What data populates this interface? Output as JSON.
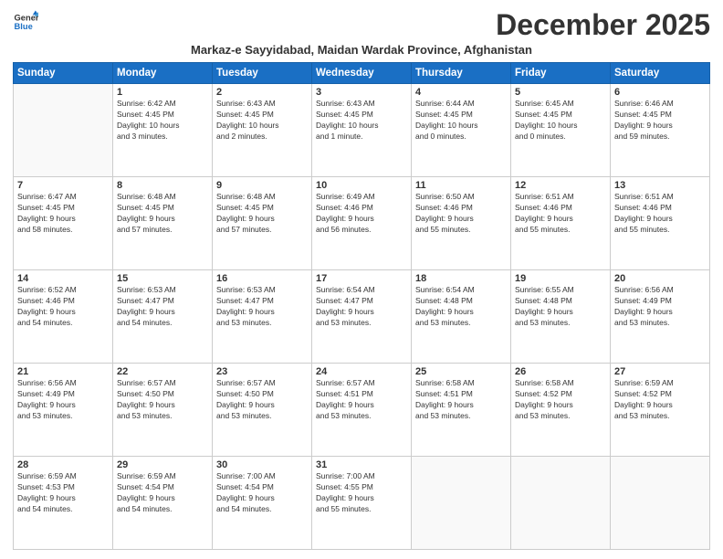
{
  "logo": {
    "line1": "General",
    "line2": "Blue"
  },
  "title": "December 2025",
  "subtitle": "Markaz-e Sayyidabad, Maidan Wardak Province, Afghanistan",
  "weekdays": [
    "Sunday",
    "Monday",
    "Tuesday",
    "Wednesday",
    "Thursday",
    "Friday",
    "Saturday"
  ],
  "weeks": [
    [
      {
        "day": "",
        "info": ""
      },
      {
        "day": "1",
        "info": "Sunrise: 6:42 AM\nSunset: 4:45 PM\nDaylight: 10 hours\nand 3 minutes."
      },
      {
        "day": "2",
        "info": "Sunrise: 6:43 AM\nSunset: 4:45 PM\nDaylight: 10 hours\nand 2 minutes."
      },
      {
        "day": "3",
        "info": "Sunrise: 6:43 AM\nSunset: 4:45 PM\nDaylight: 10 hours\nand 1 minute."
      },
      {
        "day": "4",
        "info": "Sunrise: 6:44 AM\nSunset: 4:45 PM\nDaylight: 10 hours\nand 0 minutes."
      },
      {
        "day": "5",
        "info": "Sunrise: 6:45 AM\nSunset: 4:45 PM\nDaylight: 10 hours\nand 0 minutes."
      },
      {
        "day": "6",
        "info": "Sunrise: 6:46 AM\nSunset: 4:45 PM\nDaylight: 9 hours\nand 59 minutes."
      }
    ],
    [
      {
        "day": "7",
        "info": "Sunrise: 6:47 AM\nSunset: 4:45 PM\nDaylight: 9 hours\nand 58 minutes."
      },
      {
        "day": "8",
        "info": "Sunrise: 6:48 AM\nSunset: 4:45 PM\nDaylight: 9 hours\nand 57 minutes."
      },
      {
        "day": "9",
        "info": "Sunrise: 6:48 AM\nSunset: 4:45 PM\nDaylight: 9 hours\nand 57 minutes."
      },
      {
        "day": "10",
        "info": "Sunrise: 6:49 AM\nSunset: 4:46 PM\nDaylight: 9 hours\nand 56 minutes."
      },
      {
        "day": "11",
        "info": "Sunrise: 6:50 AM\nSunset: 4:46 PM\nDaylight: 9 hours\nand 55 minutes."
      },
      {
        "day": "12",
        "info": "Sunrise: 6:51 AM\nSunset: 4:46 PM\nDaylight: 9 hours\nand 55 minutes."
      },
      {
        "day": "13",
        "info": "Sunrise: 6:51 AM\nSunset: 4:46 PM\nDaylight: 9 hours\nand 55 minutes."
      }
    ],
    [
      {
        "day": "14",
        "info": "Sunrise: 6:52 AM\nSunset: 4:46 PM\nDaylight: 9 hours\nand 54 minutes."
      },
      {
        "day": "15",
        "info": "Sunrise: 6:53 AM\nSunset: 4:47 PM\nDaylight: 9 hours\nand 54 minutes."
      },
      {
        "day": "16",
        "info": "Sunrise: 6:53 AM\nSunset: 4:47 PM\nDaylight: 9 hours\nand 53 minutes."
      },
      {
        "day": "17",
        "info": "Sunrise: 6:54 AM\nSunset: 4:47 PM\nDaylight: 9 hours\nand 53 minutes."
      },
      {
        "day": "18",
        "info": "Sunrise: 6:54 AM\nSunset: 4:48 PM\nDaylight: 9 hours\nand 53 minutes."
      },
      {
        "day": "19",
        "info": "Sunrise: 6:55 AM\nSunset: 4:48 PM\nDaylight: 9 hours\nand 53 minutes."
      },
      {
        "day": "20",
        "info": "Sunrise: 6:56 AM\nSunset: 4:49 PM\nDaylight: 9 hours\nand 53 minutes."
      }
    ],
    [
      {
        "day": "21",
        "info": "Sunrise: 6:56 AM\nSunset: 4:49 PM\nDaylight: 9 hours\nand 53 minutes."
      },
      {
        "day": "22",
        "info": "Sunrise: 6:57 AM\nSunset: 4:50 PM\nDaylight: 9 hours\nand 53 minutes."
      },
      {
        "day": "23",
        "info": "Sunrise: 6:57 AM\nSunset: 4:50 PM\nDaylight: 9 hours\nand 53 minutes."
      },
      {
        "day": "24",
        "info": "Sunrise: 6:57 AM\nSunset: 4:51 PM\nDaylight: 9 hours\nand 53 minutes."
      },
      {
        "day": "25",
        "info": "Sunrise: 6:58 AM\nSunset: 4:51 PM\nDaylight: 9 hours\nand 53 minutes."
      },
      {
        "day": "26",
        "info": "Sunrise: 6:58 AM\nSunset: 4:52 PM\nDaylight: 9 hours\nand 53 minutes."
      },
      {
        "day": "27",
        "info": "Sunrise: 6:59 AM\nSunset: 4:52 PM\nDaylight: 9 hours\nand 53 minutes."
      }
    ],
    [
      {
        "day": "28",
        "info": "Sunrise: 6:59 AM\nSunset: 4:53 PM\nDaylight: 9 hours\nand 54 minutes."
      },
      {
        "day": "29",
        "info": "Sunrise: 6:59 AM\nSunset: 4:54 PM\nDaylight: 9 hours\nand 54 minutes."
      },
      {
        "day": "30",
        "info": "Sunrise: 7:00 AM\nSunset: 4:54 PM\nDaylight: 9 hours\nand 54 minutes."
      },
      {
        "day": "31",
        "info": "Sunrise: 7:00 AM\nSunset: 4:55 PM\nDaylight: 9 hours\nand 55 minutes."
      },
      {
        "day": "",
        "info": ""
      },
      {
        "day": "",
        "info": ""
      },
      {
        "day": "",
        "info": ""
      }
    ]
  ]
}
